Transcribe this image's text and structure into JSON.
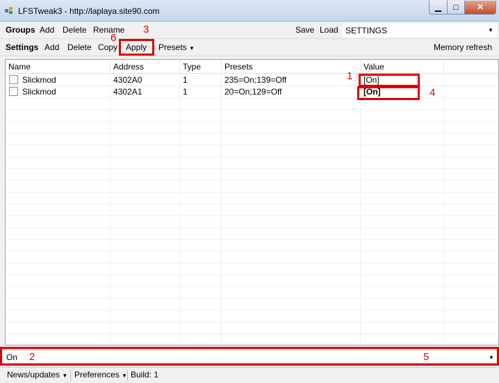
{
  "window": {
    "title": "LFSTweak3 - http://laplaya.site90.com",
    "minimize_glyph": "▁",
    "maximize_glyph": "□",
    "close_glyph": "✕"
  },
  "groups_toolbar": {
    "label": "Groups",
    "add": "Add",
    "delete": "Delete",
    "rename": "Rename",
    "save": "Save",
    "load": "Load",
    "selected_group": "SETTINGS"
  },
  "settings_toolbar": {
    "label": "Settings",
    "add": "Add",
    "delete": "Delete",
    "copy": "Copy",
    "apply": "Apply",
    "presets": "Presets",
    "memory_refresh": "Memory refresh"
  },
  "grid": {
    "columns": [
      "Name",
      "Address",
      "Type",
      "Presets",
      "Value"
    ],
    "rows": [
      {
        "name": "Slickmod",
        "address": "4302A0",
        "type": "1",
        "presets": "235=On;139=Off",
        "value": "[On]"
      },
      {
        "name": "Slickmod",
        "address": "4302A1",
        "type": "1",
        "presets": "20=On;129=Off",
        "value": "[On]"
      }
    ]
  },
  "value_combo": {
    "selected": "On"
  },
  "statusbar": {
    "news": "News/updates",
    "preferences": "Preferences",
    "build": "Build: 1"
  },
  "annotations": [
    "1",
    "2",
    "3",
    "4",
    "5",
    "6"
  ],
  "colors": {
    "annotation": "#e00000"
  }
}
